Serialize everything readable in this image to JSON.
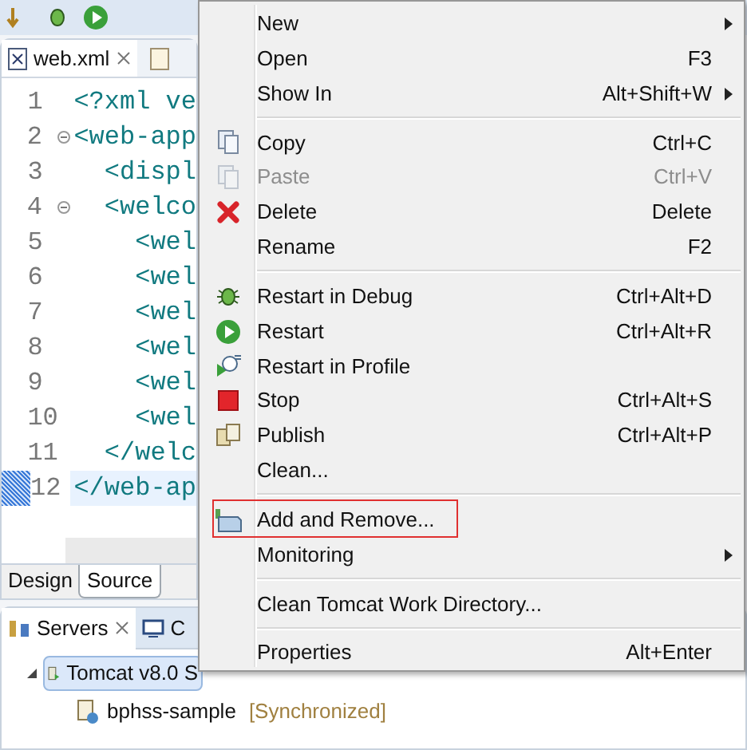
{
  "editor": {
    "tabs": [
      {
        "label": "web.xml",
        "selected": true
      }
    ],
    "lines": [
      {
        "number": "1",
        "text": "<?xml ve",
        "fold": false
      },
      {
        "number": "2",
        "text": "<web-app",
        "fold": true
      },
      {
        "number": "3",
        "text": "  <displ",
        "fold": false
      },
      {
        "number": "4",
        "text": "  <welco",
        "fold": true
      },
      {
        "number": "5",
        "text": "    <wel",
        "fold": false
      },
      {
        "number": "6",
        "text": "    <wel",
        "fold": false
      },
      {
        "number": "7",
        "text": "    <wel",
        "fold": false
      },
      {
        "number": "8",
        "text": "    <wel",
        "fold": false
      },
      {
        "number": "9",
        "text": "    <wel",
        "fold": false
      },
      {
        "number": "10",
        "text": "    <wel",
        "fold": false
      },
      {
        "number": "11",
        "text": "  </welc",
        "fold": false
      },
      {
        "number": "12",
        "text": "</web-ap",
        "fold": false,
        "current": true
      }
    ],
    "bottom_tabs": [
      {
        "label": "Design",
        "selected": false
      },
      {
        "label": "Source",
        "selected": true
      }
    ]
  },
  "servers": {
    "tabs": [
      {
        "label": "Servers",
        "selected": true
      },
      {
        "label": "C",
        "selected": false
      }
    ],
    "tree": [
      {
        "label": "Tomcat v8.0 S",
        "expanded": true,
        "selected": true,
        "children": [
          {
            "label": "bphss-sample",
            "status": "[Synchronized]"
          }
        ]
      }
    ]
  },
  "context_menu": [
    {
      "kind": "item",
      "label": "New",
      "submenu": true
    },
    {
      "kind": "item",
      "label": "Open",
      "shortcut": "F3"
    },
    {
      "kind": "item",
      "label": "Show In",
      "shortcut": "Alt+Shift+W",
      "submenu": true
    },
    {
      "kind": "separator"
    },
    {
      "kind": "item",
      "label": "Copy",
      "shortcut": "Ctrl+C"
    },
    {
      "kind": "item",
      "label": "Paste",
      "shortcut": "Ctrl+V",
      "disabled": true
    },
    {
      "kind": "item",
      "label": "Delete",
      "shortcut": "Delete"
    },
    {
      "kind": "item",
      "label": "Rename",
      "shortcut": "F2"
    },
    {
      "kind": "separator"
    },
    {
      "kind": "item",
      "label": "Restart in Debug",
      "shortcut": "Ctrl+Alt+D"
    },
    {
      "kind": "item",
      "label": "Restart",
      "shortcut": "Ctrl+Alt+R"
    },
    {
      "kind": "item",
      "label": "Restart in Profile"
    },
    {
      "kind": "item",
      "label": "Stop",
      "shortcut": "Ctrl+Alt+S"
    },
    {
      "kind": "item",
      "label": "Publish",
      "shortcut": "Ctrl+Alt+P"
    },
    {
      "kind": "item",
      "label": "Clean..."
    },
    {
      "kind": "separator"
    },
    {
      "kind": "item",
      "label": "Add and Remove...",
      "highlighted": true
    },
    {
      "kind": "item",
      "label": "Monitoring",
      "submenu": true
    },
    {
      "kind": "separator"
    },
    {
      "kind": "item",
      "label": "Clean Tomcat Work Directory..."
    },
    {
      "kind": "separator"
    },
    {
      "kind": "item",
      "label": "Properties",
      "shortcut": "Alt+Enter"
    }
  ]
}
